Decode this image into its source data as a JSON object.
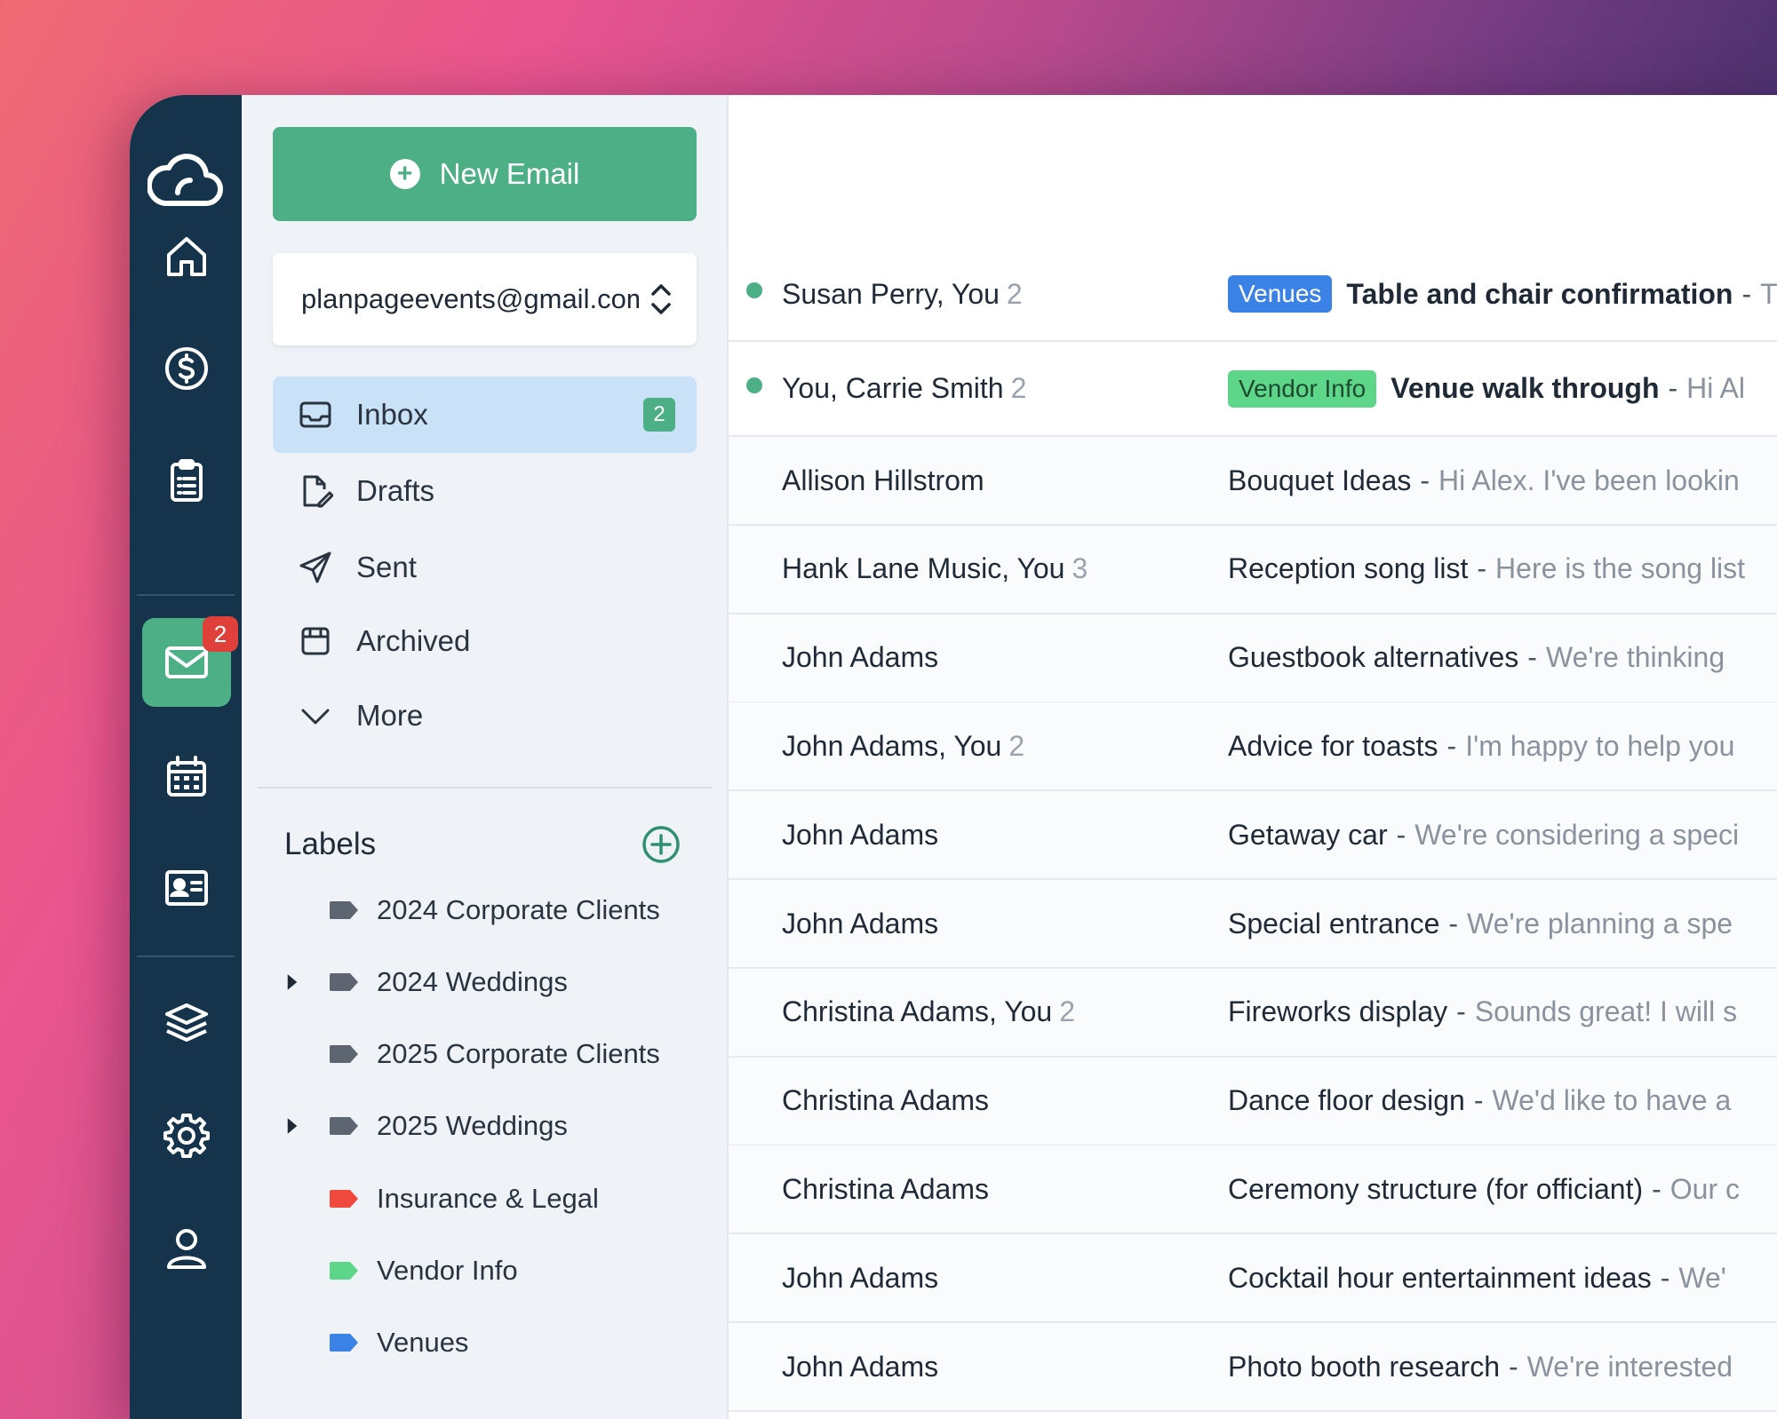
{
  "colors": {
    "rail": "#15334a",
    "accent": "#4caf85",
    "inbox_active": "#c9e2f8",
    "badge_red": "#e0403a",
    "tag_venues": "#3b82e6",
    "tag_vendor": "#5ed68a",
    "tag_insurance": "#ef4a3c",
    "tag_grey": "#5d6670"
  },
  "rail": {
    "items": [
      {
        "icon": "home-icon"
      },
      {
        "icon": "dollar-icon"
      },
      {
        "icon": "clipboard-icon"
      },
      {
        "icon": "mail-icon",
        "active": true,
        "badge": "2"
      },
      {
        "icon": "calendar-icon"
      },
      {
        "icon": "contact-card-icon"
      },
      {
        "icon": "layers-icon"
      },
      {
        "icon": "gear-icon"
      },
      {
        "icon": "user-icon"
      }
    ]
  },
  "sidebar": {
    "new_email_label": "New Email",
    "account": "planpageevents@gmail.com",
    "nav": [
      {
        "label": "Inbox",
        "icon": "inbox-icon",
        "count": "2",
        "active": true
      },
      {
        "label": "Drafts",
        "icon": "drafts-icon"
      },
      {
        "label": "Sent",
        "icon": "send-icon"
      },
      {
        "label": "Archived",
        "icon": "archive-icon"
      },
      {
        "label": "More",
        "icon": "chevron-down-icon"
      }
    ],
    "labels_title": "Labels",
    "labels": [
      {
        "name": "2024 Corporate Clients",
        "color": "#5d6670",
        "expandable": false
      },
      {
        "name": "2024 Weddings",
        "color": "#5d6670",
        "expandable": true
      },
      {
        "name": "2025 Corporate Clients",
        "color": "#5d6670",
        "expandable": false
      },
      {
        "name": "2025 Weddings",
        "color": "#5d6670",
        "expandable": true
      },
      {
        "name": "Insurance & Legal",
        "color": "#ef4a3c",
        "expandable": false
      },
      {
        "name": "Vendor Info",
        "color": "#5ed68a",
        "expandable": false
      },
      {
        "name": "Venues",
        "color": "#3b82e6",
        "expandable": false
      }
    ]
  },
  "emails": [
    {
      "sender": "Susan Perry, You",
      "count": "2",
      "unread": true,
      "tag": "Venues",
      "tag_bg": "#3b82e6",
      "tag_fg": "#ffffff",
      "subject": "Table and chair confirmation",
      "preview": "T"
    },
    {
      "sender": "You, Carrie Smith",
      "count": "2",
      "unread": true,
      "tag": "Vendor Info",
      "tag_bg": "#5ed68a",
      "tag_fg": "#1f4a30",
      "subject": "Venue walk through",
      "preview": "Hi Al"
    },
    {
      "sender": "Allison Hillstrom",
      "count": "",
      "unread": false,
      "subject": "Bouquet Ideas",
      "preview": "Hi Alex. I've been lookin"
    },
    {
      "sender": "Hank Lane Music, You",
      "count": "3",
      "unread": false,
      "subject": "Reception song list",
      "preview": "Here is the song list"
    },
    {
      "sender": "John Adams",
      "count": "",
      "unread": false,
      "subject": "Guestbook alternatives",
      "preview": "We're thinking"
    },
    {
      "sender": "John Adams, You",
      "count": "2",
      "unread": false,
      "subject": "Advice for toasts",
      "preview": "I'm happy to help you"
    },
    {
      "sender": "John Adams",
      "count": "",
      "unread": false,
      "subject": "Getaway car",
      "preview": "We're considering a speci"
    },
    {
      "sender": "John Adams",
      "count": "",
      "unread": false,
      "subject": "Special entrance",
      "preview": "We're planning a spe"
    },
    {
      "sender": "Christina Adams, You",
      "count": "2",
      "unread": false,
      "subject": "Fireworks display",
      "preview": "Sounds great! I will s"
    },
    {
      "sender": "Christina Adams",
      "count": "",
      "unread": false,
      "subject": "Dance floor design",
      "preview": "We'd like to have a"
    },
    {
      "sender": "Christina Adams",
      "count": "",
      "unread": false,
      "subject": "Ceremony structure (for officiant)",
      "preview": "Our c"
    },
    {
      "sender": "John Adams",
      "count": "",
      "unread": false,
      "subject": "Cocktail hour entertainment ideas",
      "preview": "We'"
    },
    {
      "sender": "John Adams",
      "count": "",
      "unread": false,
      "subject": "Photo booth research",
      "preview": "We're interested"
    }
  ]
}
